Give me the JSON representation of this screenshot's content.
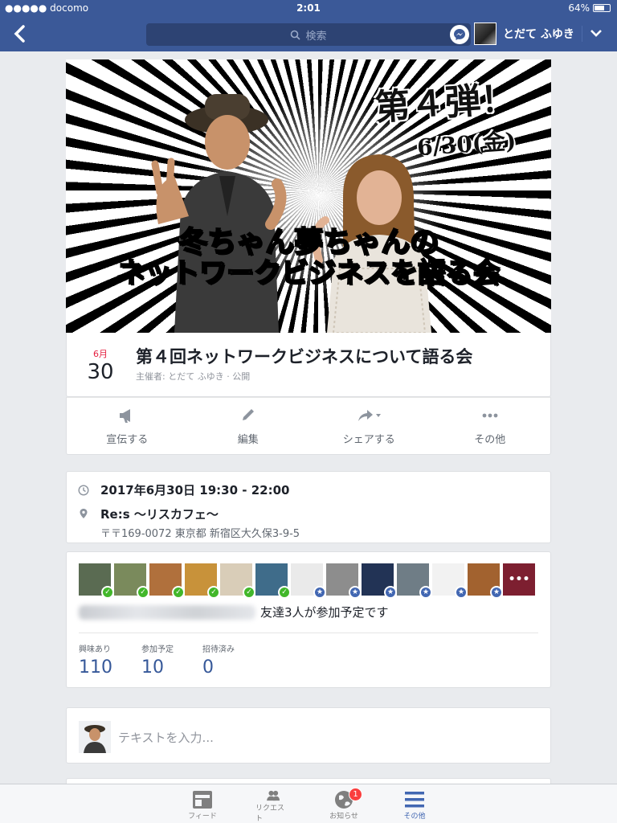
{
  "status_bar": {
    "carrier": "●●●●● docomo",
    "time": "2:01",
    "battery": "64%"
  },
  "nav": {
    "search_placeholder": "検索",
    "user_name": "とだて ふゆき"
  },
  "hero": {
    "badge": "第４弾！",
    "badge_date": "6/30(金)",
    "title_line1": "冬ちゃん夢ちゃんの",
    "title_line2": "ネットワークビジネスを語る会"
  },
  "event": {
    "month": "6月",
    "day": "30",
    "title": "第４回ネットワークビジネスについて語る会",
    "host_line": "主催者: とだて ふゆき · 公開"
  },
  "actions": [
    {
      "label": "宣伝する",
      "icon": "megaphone-icon"
    },
    {
      "label": "編集",
      "icon": "pencil-icon"
    },
    {
      "label": "シェアする",
      "icon": "share-icon"
    },
    {
      "label": "その他",
      "icon": "more-icon"
    }
  ],
  "details": {
    "when": "2017年6月30日 19:30 - 22:00",
    "place_name": "Re:s 〜リスカフェ〜",
    "place_address": "〒〒169-0072 東京都 新宿区大久保3-9-5"
  },
  "people": {
    "avatars": [
      {
        "status": "going",
        "color": "#5a6b52"
      },
      {
        "status": "going",
        "color": "#7a8a5c"
      },
      {
        "status": "going",
        "color": "#b0703c"
      },
      {
        "status": "going",
        "color": "#c8923a"
      },
      {
        "status": "going",
        "color": "#d9cdb8"
      },
      {
        "status": "going",
        "color": "#3f6c8a"
      },
      {
        "status": "invited",
        "color": "#eaeaea"
      },
      {
        "status": "invited",
        "color": "#8d8d8d"
      },
      {
        "status": "invited",
        "color": "#223355"
      },
      {
        "status": "invited",
        "color": "#6f7d86"
      },
      {
        "status": "invited",
        "color": "#f2f2f2"
      },
      {
        "status": "invited",
        "color": "#a2622f"
      },
      {
        "status": "more",
        "color": "#c0304a"
      }
    ],
    "friends_text": "友達3人が参加予定です",
    "more_label": "•••",
    "stats": [
      {
        "label": "興味あり",
        "value": "110"
      },
      {
        "label": "参加予定",
        "value": "10"
      },
      {
        "label": "招待済み",
        "value": "0"
      }
    ]
  },
  "composer": {
    "placeholder": "テキストを入力..."
  },
  "tabbar": [
    {
      "label": "フィード",
      "icon": "feed-icon",
      "active": false
    },
    {
      "label": "リクエスト",
      "icon": "friends-icon",
      "active": false
    },
    {
      "label": "お知らせ",
      "icon": "globe-icon",
      "active": false,
      "badge": "1"
    },
    {
      "label": "その他",
      "icon": "menu-icon",
      "active": true
    }
  ],
  "colors": {
    "brand": "#3b5998",
    "accent": "#4267b2",
    "date_red": "#e41e3f",
    "going": "#42b72a"
  }
}
